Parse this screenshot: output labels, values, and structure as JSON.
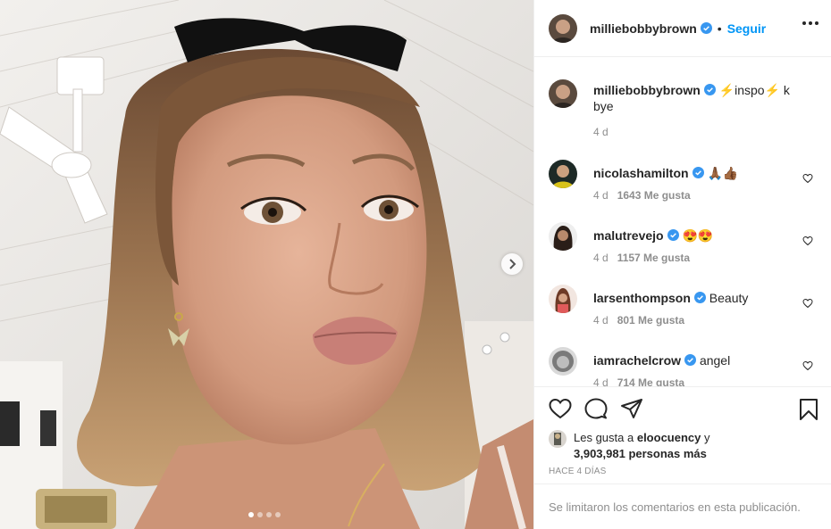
{
  "post": {
    "author": "milliebobbybrown",
    "follow_label": "Seguir",
    "separator": "•",
    "caption": {
      "user": "milliebobbybrown",
      "text_part1": "inspo",
      "text_part2": " k bye",
      "emoji": "⚡",
      "age": "4 d"
    },
    "photo": {
      "carousel_dots": 4,
      "active_dot": 0
    }
  },
  "comments": [
    {
      "user": "nicolashamilton",
      "verified": true,
      "text": "🙏🏾👍🏾",
      "age": "4 d",
      "likes": "1643 Me gusta"
    },
    {
      "user": "malutrevejo",
      "verified": true,
      "text": "😍😍",
      "age": "4 d",
      "likes": "1157 Me gusta"
    },
    {
      "user": "larsenthompson",
      "verified": true,
      "text": "Beauty",
      "age": "4 d",
      "likes": "801 Me gusta"
    },
    {
      "user": "iamrachelcrow",
      "verified": true,
      "text": "angel",
      "age": "4 d",
      "likes": "714 Me gusta"
    }
  ],
  "likes": {
    "prefix": "Les gusta a",
    "user": "eloocuency",
    "conj": "y",
    "count": "3,903,981 personas más"
  },
  "timestamp": "HACE 4 DÍAS",
  "comments_limited": "Se limitaron los comentarios en esta publicación.",
  "colors": {
    "accent": "#0095f6",
    "text": "#262626",
    "muted": "#8e8e8e",
    "border": "#efefef"
  }
}
